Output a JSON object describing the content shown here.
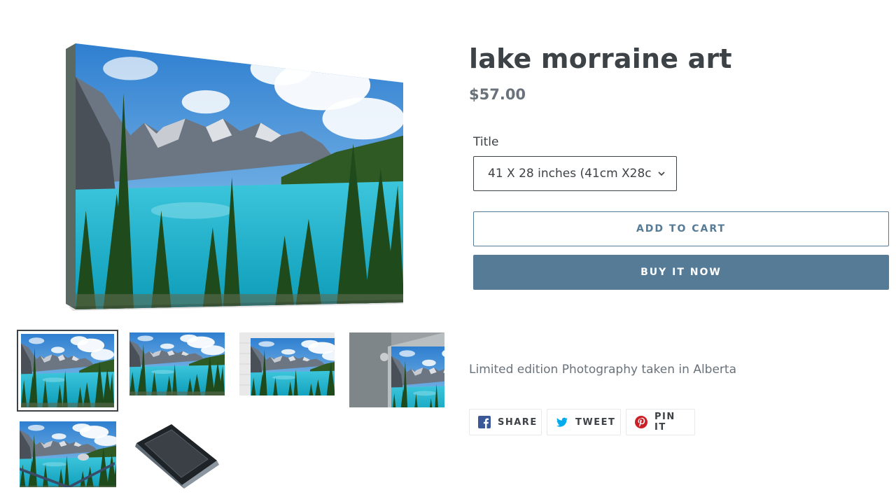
{
  "product": {
    "title": "lake morraine art",
    "price": "$57.00",
    "description": "Limited edition Photography taken in Alberta"
  },
  "options": {
    "label": "Title",
    "selected": "41 X 28 inches (41cm X28c"
  },
  "buttons": {
    "add_to_cart": "ADD TO CART",
    "buy_now": "BUY IT NOW"
  },
  "share": [
    {
      "label": "SHARE",
      "icon": "facebook-icon",
      "color": "#3b5998"
    },
    {
      "label": "TWEET",
      "icon": "twitter-icon",
      "color": "#00aced"
    },
    {
      "label": "PIN IT",
      "icon": "pinterest-icon",
      "color": "#cb2027"
    }
  ],
  "colors": {
    "accent": "#557b97",
    "text": "#3d4246",
    "muted": "#69727b"
  }
}
